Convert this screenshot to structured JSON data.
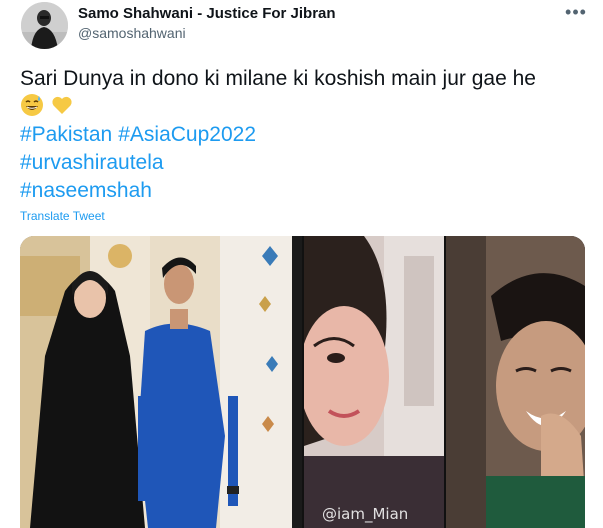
{
  "author": {
    "name": "Samo Shahwani - Justice For Jibran",
    "handle": "@samoshahwani"
  },
  "menu_icon": "more-dots-icon",
  "tweet": {
    "text": "Sari Dunya in dono ki milane ki koshish main jur gae he",
    "emojis": [
      "grinning-sweat-emoji",
      "yellow-heart-emoji"
    ],
    "hashtags_line1": [
      "#Pakistan",
      "#AsiaCup2022"
    ],
    "hashtag_line2": "#urvashirautela",
    "hashtag_line3": "#naseemshah",
    "translate_label": "Translate Tweet"
  },
  "media": {
    "watermark": "@iam_Mian"
  },
  "colors": {
    "link": "#1d9bf0",
    "secondary_text": "#536471",
    "primary_text": "#0f1419"
  }
}
